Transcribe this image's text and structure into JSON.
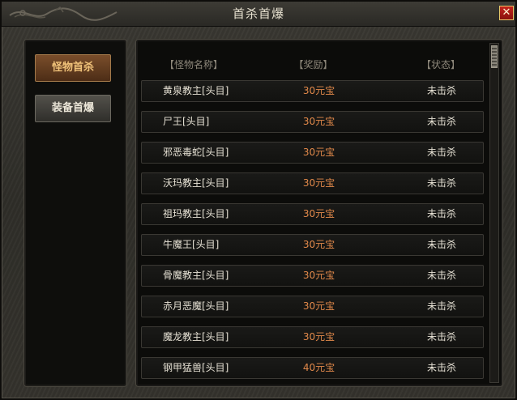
{
  "window": {
    "title": "首杀首爆",
    "close_label": "✕"
  },
  "sidebar": {
    "items": [
      {
        "label": "怪物首杀",
        "active": true
      },
      {
        "label": "装备首爆",
        "active": false
      }
    ]
  },
  "table": {
    "headers": {
      "name": "【怪物名称】",
      "reward": "【奖励】",
      "status": "【状态】"
    },
    "rows": [
      {
        "name": "黄泉教主[头目]",
        "reward": "30元宝",
        "status": "未击杀"
      },
      {
        "name": "尸王[头目]",
        "reward": "30元宝",
        "status": "未击杀"
      },
      {
        "name": "邪恶毒蛇[头目]",
        "reward": "30元宝",
        "status": "未击杀"
      },
      {
        "name": "沃玛教主[头目]",
        "reward": "30元宝",
        "status": "未击杀"
      },
      {
        "name": "祖玛教主[头目]",
        "reward": "30元宝",
        "status": "未击杀"
      },
      {
        "name": "牛魔王[头目]",
        "reward": "30元宝",
        "status": "未击杀"
      },
      {
        "name": "骨魔教主[头目]",
        "reward": "30元宝",
        "status": "未击杀"
      },
      {
        "name": "赤月恶魔[头目]",
        "reward": "30元宝",
        "status": "未击杀"
      },
      {
        "name": "魔龙教主[头目]",
        "reward": "30元宝",
        "status": "未击杀"
      },
      {
        "name": "钢甲猛兽[头目]",
        "reward": "40元宝",
        "status": "未击杀"
      }
    ]
  },
  "colors": {
    "reward": "#e2894a",
    "active_tab_text": "#f0c27a",
    "title_text": "#e6e0cf"
  }
}
